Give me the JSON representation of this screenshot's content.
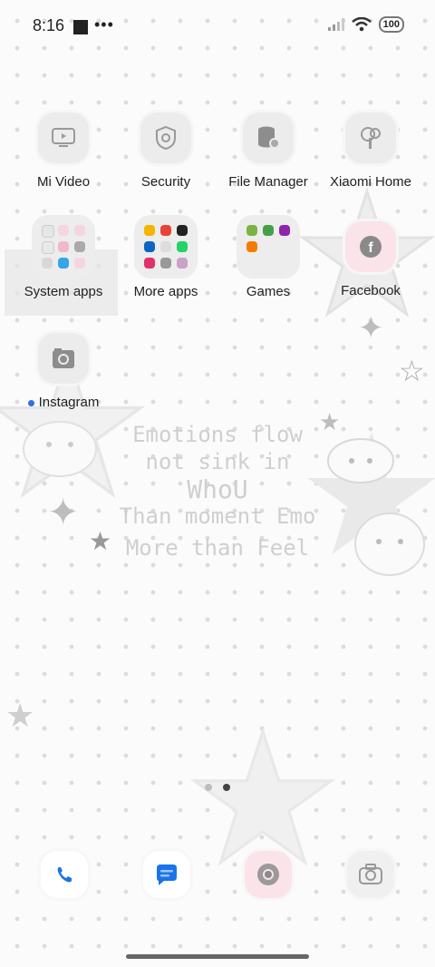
{
  "status_bar": {
    "time": "8:16",
    "more_glyph": "•••",
    "battery": "100"
  },
  "wallpaper": {
    "lines": [
      "Emotions flow",
      "not sink in",
      "WhoU",
      "Than moment Emo",
      "More than Feel"
    ]
  },
  "apps": {
    "mi_video": "Mi Video",
    "security": "Security",
    "file_manager": "File Manager",
    "xiaomi_home": "Xiaomi Home",
    "system_apps": "System apps",
    "more_apps": "More apps",
    "games": "Games",
    "facebook": "Facebook",
    "instagram": "Instagram"
  },
  "page_indicator": {
    "count": 2,
    "active": 2
  },
  "dock": [
    "Phone",
    "Messages",
    "Chrome",
    "Camera"
  ],
  "colors": {
    "phone": "#1a73e8",
    "messages": "#1a73e8",
    "notification_dot": "#2f6fe6",
    "facebook_bg": "#fbe3ea",
    "chrome_bg": "#fbe3ea"
  }
}
